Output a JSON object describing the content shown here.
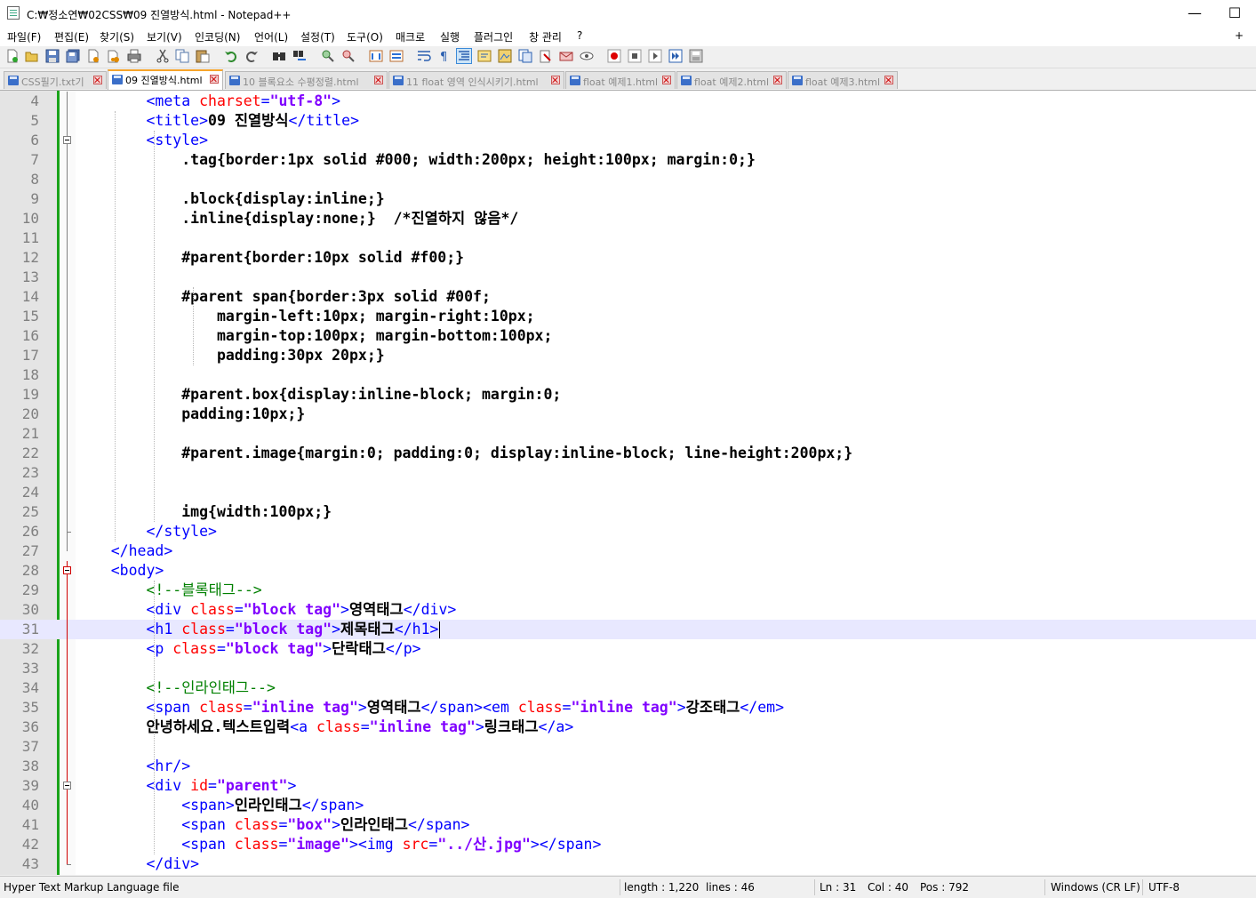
{
  "window": {
    "title": "C:₩정소연₩02CSS₩09 진열방식.html - Notepad++",
    "minimize": "—",
    "maximize": "☐",
    "close": "✕"
  },
  "menu": [
    "파일(F)",
    "편집(E)",
    "찾기(S)",
    "보기(V)",
    "인코딩(N)",
    "언어(L)",
    "설정(T)",
    "도구(O)",
    "매크로",
    "실행",
    "플러그인",
    "창 관리",
    "?"
  ],
  "menu_plus": "+",
  "toolbar": [
    "new-file-icon",
    "open-file-icon",
    "save-icon",
    "save-all-icon",
    "close-icon",
    "close-all-icon",
    "print-icon",
    "cut-icon",
    "copy-icon",
    "paste-icon",
    "undo-icon",
    "redo-icon",
    "find-icon",
    "replace-icon",
    "zoom-in-icon",
    "zoom-out-icon",
    "sync-vertical-icon",
    "sync-horizontal-icon",
    "word-wrap-icon",
    "show-all-chars-icon",
    "indent-guide-icon",
    "user-lang-icon",
    "doc-map-icon",
    "function-list-icon",
    "folder-workspace-icon",
    "monitor-icon",
    "macro-record-icon",
    "macro-stop-icon",
    "macro-play-icon",
    "macro-run-multiple-icon",
    "macro-save-icon"
  ],
  "tabs": [
    {
      "label": "CSS필기.txt기",
      "active": false
    },
    {
      "label": "09 진열방식.html",
      "active": true
    },
    {
      "label": "10 블록요소 수평정렬.html",
      "active": false
    },
    {
      "label": "11 float 영역 인식시키기.html",
      "active": false
    },
    {
      "label": "float 예제1.html",
      "active": false
    },
    {
      "label": "float 예제2.html",
      "active": false
    },
    {
      "label": "float 예제3.html",
      "active": false
    }
  ],
  "editor": {
    "current_line": 31,
    "lines": [
      {
        "n": "4",
        "segs": [
          [
            "tag",
            "        <meta "
          ],
          [
            "attr",
            "charset"
          ],
          [
            "tag",
            "="
          ],
          [
            "val",
            "\"utf-8\""
          ],
          [
            "tag",
            ">"
          ]
        ]
      },
      {
        "n": "5",
        "segs": [
          [
            "tag",
            "        <title>"
          ],
          [
            "txt",
            "09 진열방식"
          ],
          [
            "tag",
            "</title>"
          ]
        ]
      },
      {
        "n": "6",
        "segs": [
          [
            "tag",
            "        <style>"
          ]
        ]
      },
      {
        "n": "7",
        "segs": [
          [
            "css",
            "            .tag{border:1px solid #000; width:200px; height:100px; margin:0;}"
          ]
        ]
      },
      {
        "n": "8",
        "segs": []
      },
      {
        "n": "9",
        "segs": [
          [
            "css",
            "            .block{display:inline;}"
          ]
        ]
      },
      {
        "n": "10",
        "segs": [
          [
            "css",
            "            .inline{display:none;}  /*진열하지 않음*/"
          ]
        ]
      },
      {
        "n": "11",
        "segs": []
      },
      {
        "n": "12",
        "segs": [
          [
            "css",
            "            #parent{border:10px solid #f00;}"
          ]
        ]
      },
      {
        "n": "13",
        "segs": []
      },
      {
        "n": "14",
        "segs": [
          [
            "css",
            "            #parent span{border:3px solid #00f;"
          ]
        ]
      },
      {
        "n": "15",
        "segs": [
          [
            "css",
            "                margin-left:10px; margin-right:10px;"
          ]
        ]
      },
      {
        "n": "16",
        "segs": [
          [
            "css",
            "                margin-top:100px; margin-bottom:100px;"
          ]
        ]
      },
      {
        "n": "17",
        "segs": [
          [
            "css",
            "                padding:30px 20px;}"
          ]
        ]
      },
      {
        "n": "18",
        "segs": []
      },
      {
        "n": "19",
        "segs": [
          [
            "css",
            "            #parent.box{display:inline-block; margin:0;"
          ]
        ]
      },
      {
        "n": "20",
        "segs": [
          [
            "css",
            "            padding:10px;}"
          ]
        ]
      },
      {
        "n": "21",
        "segs": []
      },
      {
        "n": "22",
        "segs": [
          [
            "css",
            "            #parent.image{margin:0; padding:0; display:inline-block; line-height:200px;}"
          ]
        ]
      },
      {
        "n": "23",
        "segs": []
      },
      {
        "n": "24",
        "segs": []
      },
      {
        "n": "25",
        "segs": [
          [
            "css",
            "            img{width:100px;}"
          ]
        ]
      },
      {
        "n": "26",
        "segs": [
          [
            "tag",
            "        </style>"
          ]
        ]
      },
      {
        "n": "27",
        "segs": [
          [
            "tag",
            "    </head>"
          ]
        ]
      },
      {
        "n": "28",
        "segs": [
          [
            "tag",
            "    <body>"
          ]
        ]
      },
      {
        "n": "29",
        "segs": [
          [
            "cmt",
            "        <!--블록태그-->"
          ]
        ]
      },
      {
        "n": "30",
        "segs": [
          [
            "tag",
            "        <div "
          ],
          [
            "attr",
            "class"
          ],
          [
            "tag",
            "="
          ],
          [
            "val",
            "\"block tag\""
          ],
          [
            "tag",
            ">"
          ],
          [
            "txt",
            "영역태그"
          ],
          [
            "tag",
            "</div>"
          ]
        ]
      },
      {
        "n": "31",
        "segs": [
          [
            "tag",
            "        <h1 "
          ],
          [
            "attr",
            "class"
          ],
          [
            "tag",
            "="
          ],
          [
            "val",
            "\"block tag\""
          ],
          [
            "tag",
            ">"
          ],
          [
            "txt",
            "제목태그"
          ],
          [
            "tag",
            "</h1>"
          ]
        ]
      },
      {
        "n": "32",
        "segs": [
          [
            "tag",
            "        <p "
          ],
          [
            "attr",
            "class"
          ],
          [
            "tag",
            "="
          ],
          [
            "val",
            "\"block tag\""
          ],
          [
            "tag",
            ">"
          ],
          [
            "txt",
            "단락태그"
          ],
          [
            "tag",
            "</p>"
          ]
        ]
      },
      {
        "n": "33",
        "segs": []
      },
      {
        "n": "34",
        "segs": [
          [
            "cmt",
            "        <!--인라인태그-->"
          ]
        ]
      },
      {
        "n": "35",
        "segs": [
          [
            "tag",
            "        <span "
          ],
          [
            "attr",
            "class"
          ],
          [
            "tag",
            "="
          ],
          [
            "val",
            "\"inline tag\""
          ],
          [
            "tag",
            ">"
          ],
          [
            "txt",
            "영역태그"
          ],
          [
            "tag",
            "</span><em "
          ],
          [
            "attr",
            "class"
          ],
          [
            "tag",
            "="
          ],
          [
            "val",
            "\"inline tag\""
          ],
          [
            "tag",
            ">"
          ],
          [
            "txt",
            "강조태그"
          ],
          [
            "tag",
            "</em>"
          ]
        ]
      },
      {
        "n": "36",
        "segs": [
          [
            "txt",
            "        안녕하세요.텍스트입력"
          ],
          [
            "tag",
            "<a "
          ],
          [
            "attr",
            "class"
          ],
          [
            "tag",
            "="
          ],
          [
            "val",
            "\"inline tag\""
          ],
          [
            "tag",
            ">"
          ],
          [
            "txt",
            "링크태그"
          ],
          [
            "tag",
            "</a>"
          ]
        ]
      },
      {
        "n": "37",
        "segs": []
      },
      {
        "n": "38",
        "segs": [
          [
            "tag",
            "        <hr/>"
          ]
        ]
      },
      {
        "n": "39",
        "segs": [
          [
            "tag",
            "        <div "
          ],
          [
            "attr",
            "id"
          ],
          [
            "tag",
            "="
          ],
          [
            "val",
            "\"parent\""
          ],
          [
            "tag",
            ">"
          ]
        ]
      },
      {
        "n": "40",
        "segs": [
          [
            "tag",
            "            <span>"
          ],
          [
            "txt",
            "인라인태그"
          ],
          [
            "tag",
            "</span>"
          ]
        ]
      },
      {
        "n": "41",
        "segs": [
          [
            "tag",
            "            <span "
          ],
          [
            "attr",
            "class"
          ],
          [
            "tag",
            "="
          ],
          [
            "val",
            "\"box\""
          ],
          [
            "tag",
            ">"
          ],
          [
            "txt",
            "인라인태그"
          ],
          [
            "tag",
            "</span>"
          ]
        ]
      },
      {
        "n": "42",
        "segs": [
          [
            "tag",
            "            <span "
          ],
          [
            "attr",
            "class"
          ],
          [
            "tag",
            "="
          ],
          [
            "val",
            "\"image\""
          ],
          [
            "tag",
            "><img "
          ],
          [
            "attr",
            "src"
          ],
          [
            "tag",
            "="
          ],
          [
            "val",
            "\"../산.jpg\""
          ],
          [
            "tag",
            "></span>"
          ]
        ]
      },
      {
        "n": "43",
        "segs": [
          [
            "tag",
            "        </div>"
          ]
        ]
      }
    ]
  },
  "status": {
    "filetype": "Hyper Text Markup Language file",
    "length": "length : 1,220",
    "lines": "lines : 46",
    "ln": "Ln : 31",
    "col": "Col : 40",
    "pos": "Pos : 792",
    "eol": "Windows (CR LF)",
    "encoding": "UTF-8"
  },
  "colors": {
    "tag": "#0000ff",
    "attr": "#ff0000",
    "value": "#8000ff",
    "comment": "#008000",
    "current_line": "#e8e8ff",
    "active_tab_accent": "#f6a42a"
  }
}
